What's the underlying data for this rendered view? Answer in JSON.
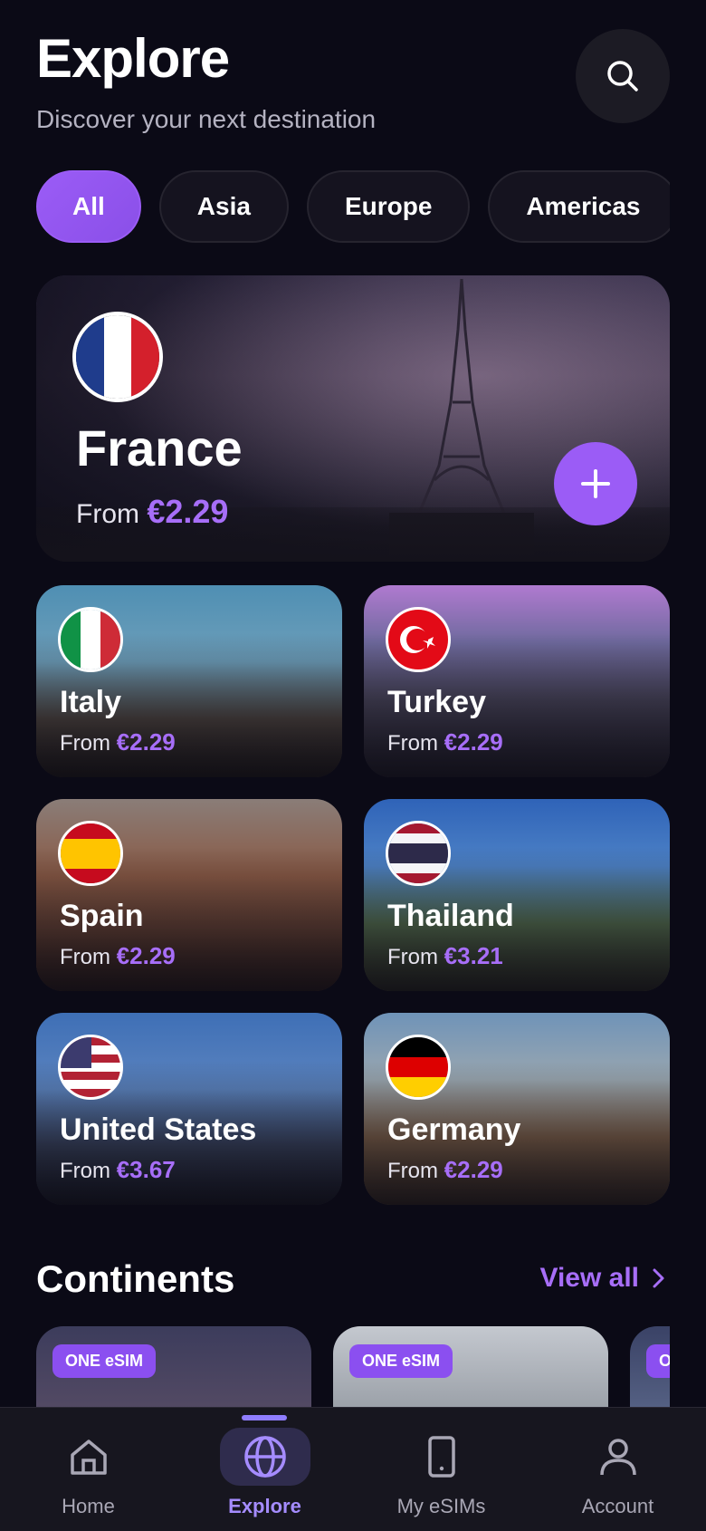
{
  "header": {
    "title": "Explore",
    "subtitle": "Discover your next destination",
    "search_icon": "search-icon"
  },
  "filters": [
    {
      "label": "All",
      "active": true
    },
    {
      "label": "Asia",
      "active": false
    },
    {
      "label": "Europe",
      "active": false
    },
    {
      "label": "Americas",
      "active": false
    }
  ],
  "featured": {
    "name": "France",
    "from_label": "From",
    "price": "€2.29",
    "add_icon": "plus-icon"
  },
  "destinations": [
    {
      "name": "Italy",
      "from_label": "From",
      "price": "€2.29"
    },
    {
      "name": "Turkey",
      "from_label": "From",
      "price": "€2.29"
    },
    {
      "name": "Spain",
      "from_label": "From",
      "price": "€2.29"
    },
    {
      "name": "Thailand",
      "from_label": "From",
      "price": "€3.21"
    },
    {
      "name": "United States",
      "from_label": "From",
      "price": "€3.67"
    },
    {
      "name": "Germany",
      "from_label": "From",
      "price": "€2.29"
    }
  ],
  "continents_section": {
    "title": "Continents",
    "view_all": "View all",
    "cards": [
      {
        "badge": "ONE eSIM"
      },
      {
        "badge": "ONE eSIM"
      },
      {
        "badge": "O"
      }
    ]
  },
  "nav": [
    {
      "label": "Home",
      "icon": "home-icon",
      "active": false
    },
    {
      "label": "Explore",
      "icon": "globe-icon",
      "active": true
    },
    {
      "label": "My eSIMs",
      "icon": "phone-icon",
      "active": false
    },
    {
      "label": "Account",
      "icon": "person-icon",
      "active": false
    }
  ],
  "colors": {
    "accent": "#9b5cf6",
    "price": "#a76ef8",
    "background": "#0b0a16"
  }
}
